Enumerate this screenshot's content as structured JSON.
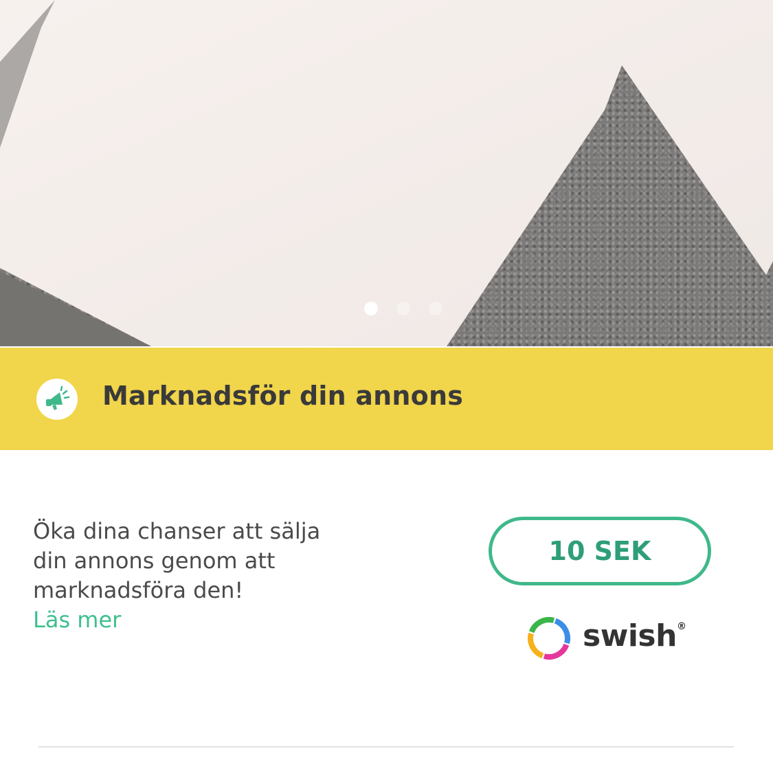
{
  "carousel": {
    "image_count": 3,
    "active_index": 0
  },
  "promo": {
    "icon": "megaphone-icon",
    "title": "Marknadsför din annons",
    "banner_color": "#f1d54a",
    "description": "Öka dina chanser att sälja din annons genom att marknadsföra den!",
    "read_more": "Läs mer",
    "price_label": "10 SEK",
    "accent_color": "#3fb88a"
  },
  "payment": {
    "logo_text": "swish",
    "registered_mark": "®"
  }
}
